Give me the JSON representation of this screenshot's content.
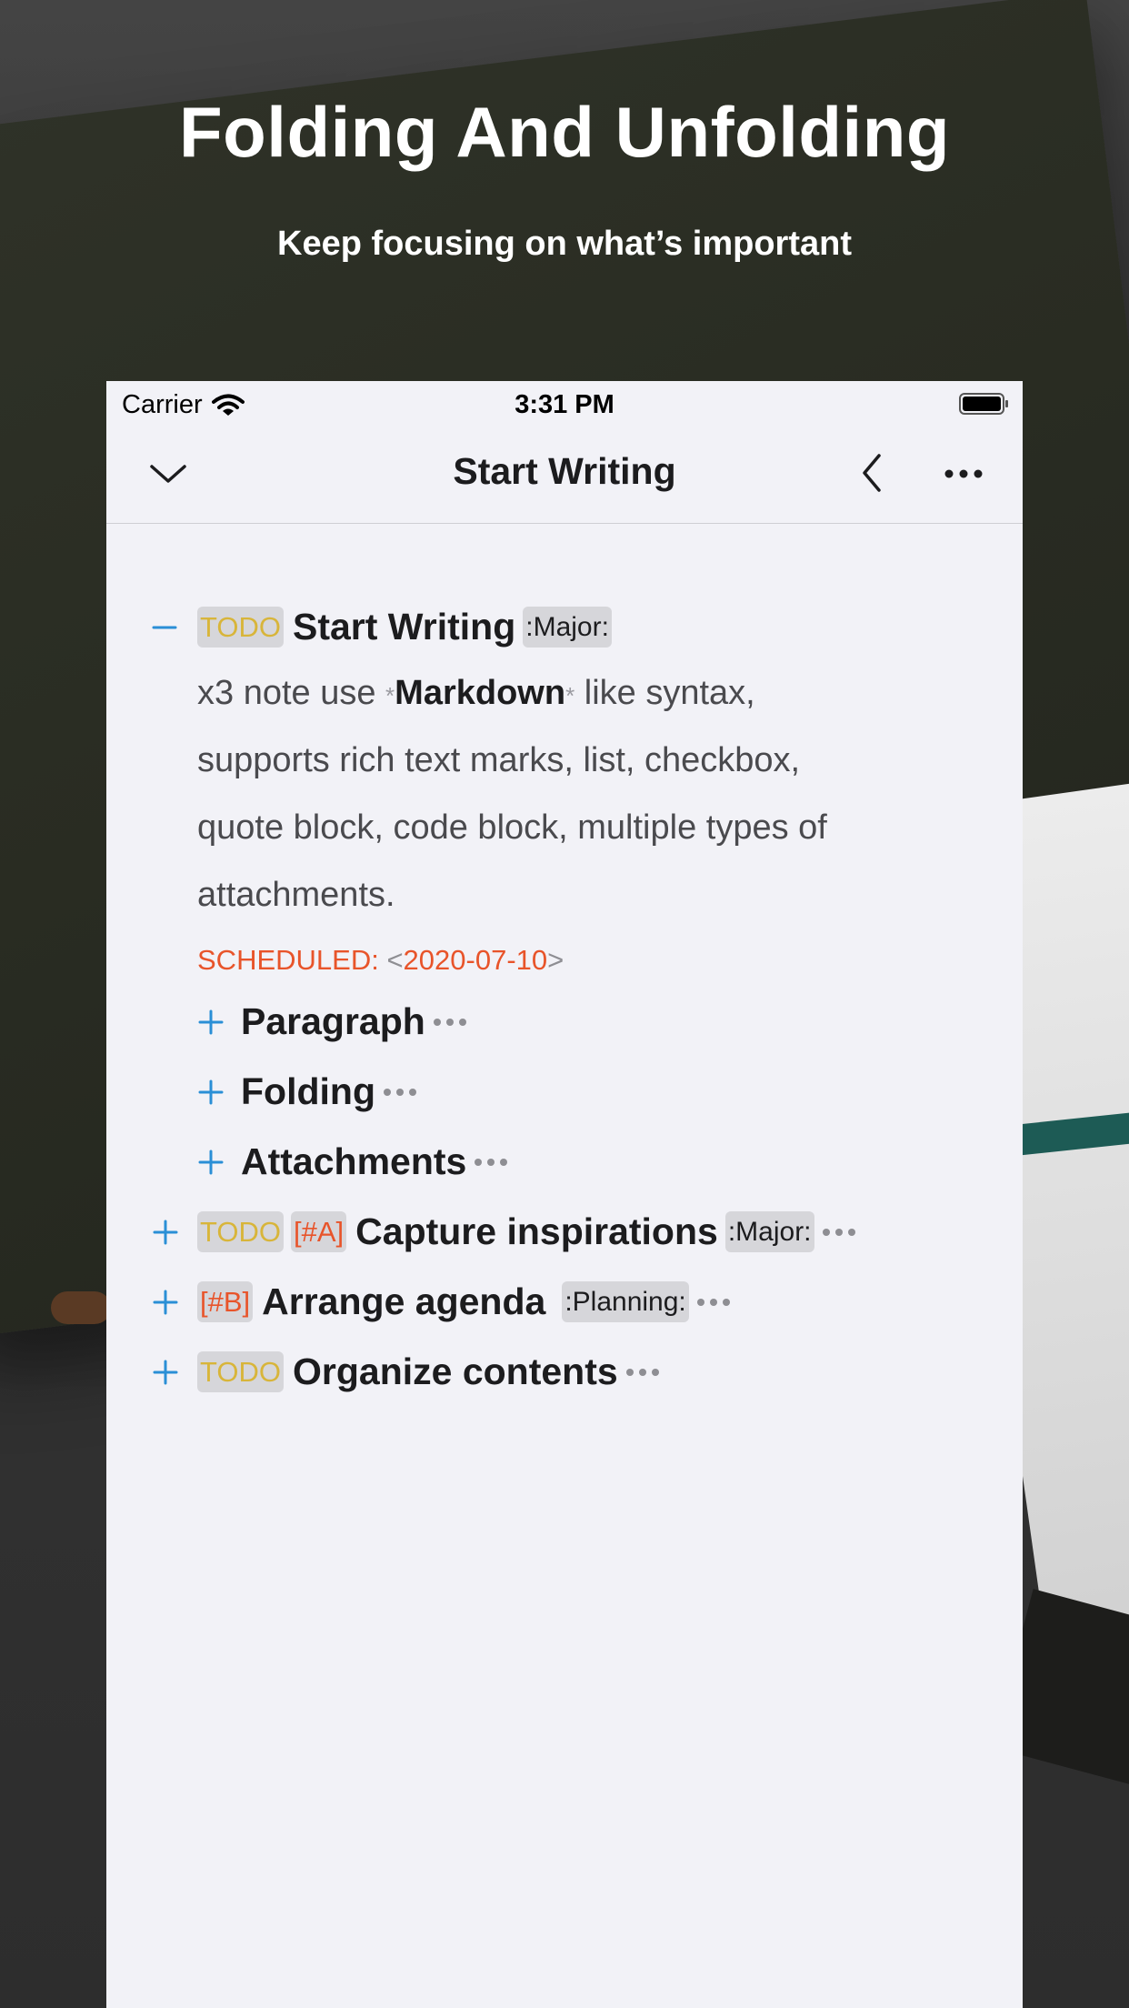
{
  "promo": {
    "headline": "Folding And Unfolding",
    "subheadline": "Keep focusing on what’s important"
  },
  "status_bar": {
    "carrier": "Carrier",
    "time": "3:31 PM",
    "icons": [
      "wifi-icon",
      "battery-icon"
    ]
  },
  "nav": {
    "title": "Start Writing",
    "icons": [
      "chevron-down-icon",
      "chevron-left-icon",
      "more-icon"
    ]
  },
  "colors": {
    "todo": "#d8b53a",
    "priority": "#e8542a",
    "toggle": "#2a8fd6",
    "badge_bg": "#d6d6da",
    "body_text": "#4a4a4e",
    "heading_text": "#1c1c1e"
  },
  "outline": {
    "main": {
      "toggle": "−",
      "state": "TODO",
      "title": "Start Writing",
      "tag": ":Major:",
      "body": {
        "line1_prefix": "x3 note use ",
        "markdown_mark_open": "*",
        "markdown_word": "Markdown",
        "markdown_mark_close": "*",
        "line1_suffix": " like syntax,",
        "line2": "supports rich text marks, list, checkbox,",
        "line3": "quote block, code block, multiple types of",
        "line4": "attachments."
      },
      "scheduled": {
        "keyword": "SCHEDULED:",
        "open": " <",
        "date": "2020-07-10",
        "close": ">"
      },
      "children": [
        {
          "toggle": "+",
          "title": "Paragraph"
        },
        {
          "toggle": "+",
          "title": "Folding"
        },
        {
          "toggle": "+",
          "title": "Attachments"
        }
      ]
    },
    "items": [
      {
        "toggle": "+",
        "state": "TODO",
        "priority": "[#A]",
        "title": "Capture inspirations",
        "tag": ":Major:"
      },
      {
        "toggle": "+",
        "state": "",
        "priority": "[#B]",
        "title": "Arrange agenda",
        "tag": ":Planning:"
      },
      {
        "toggle": "+",
        "state": "TODO",
        "priority": "",
        "title": "Organize contents",
        "tag": ""
      }
    ]
  }
}
